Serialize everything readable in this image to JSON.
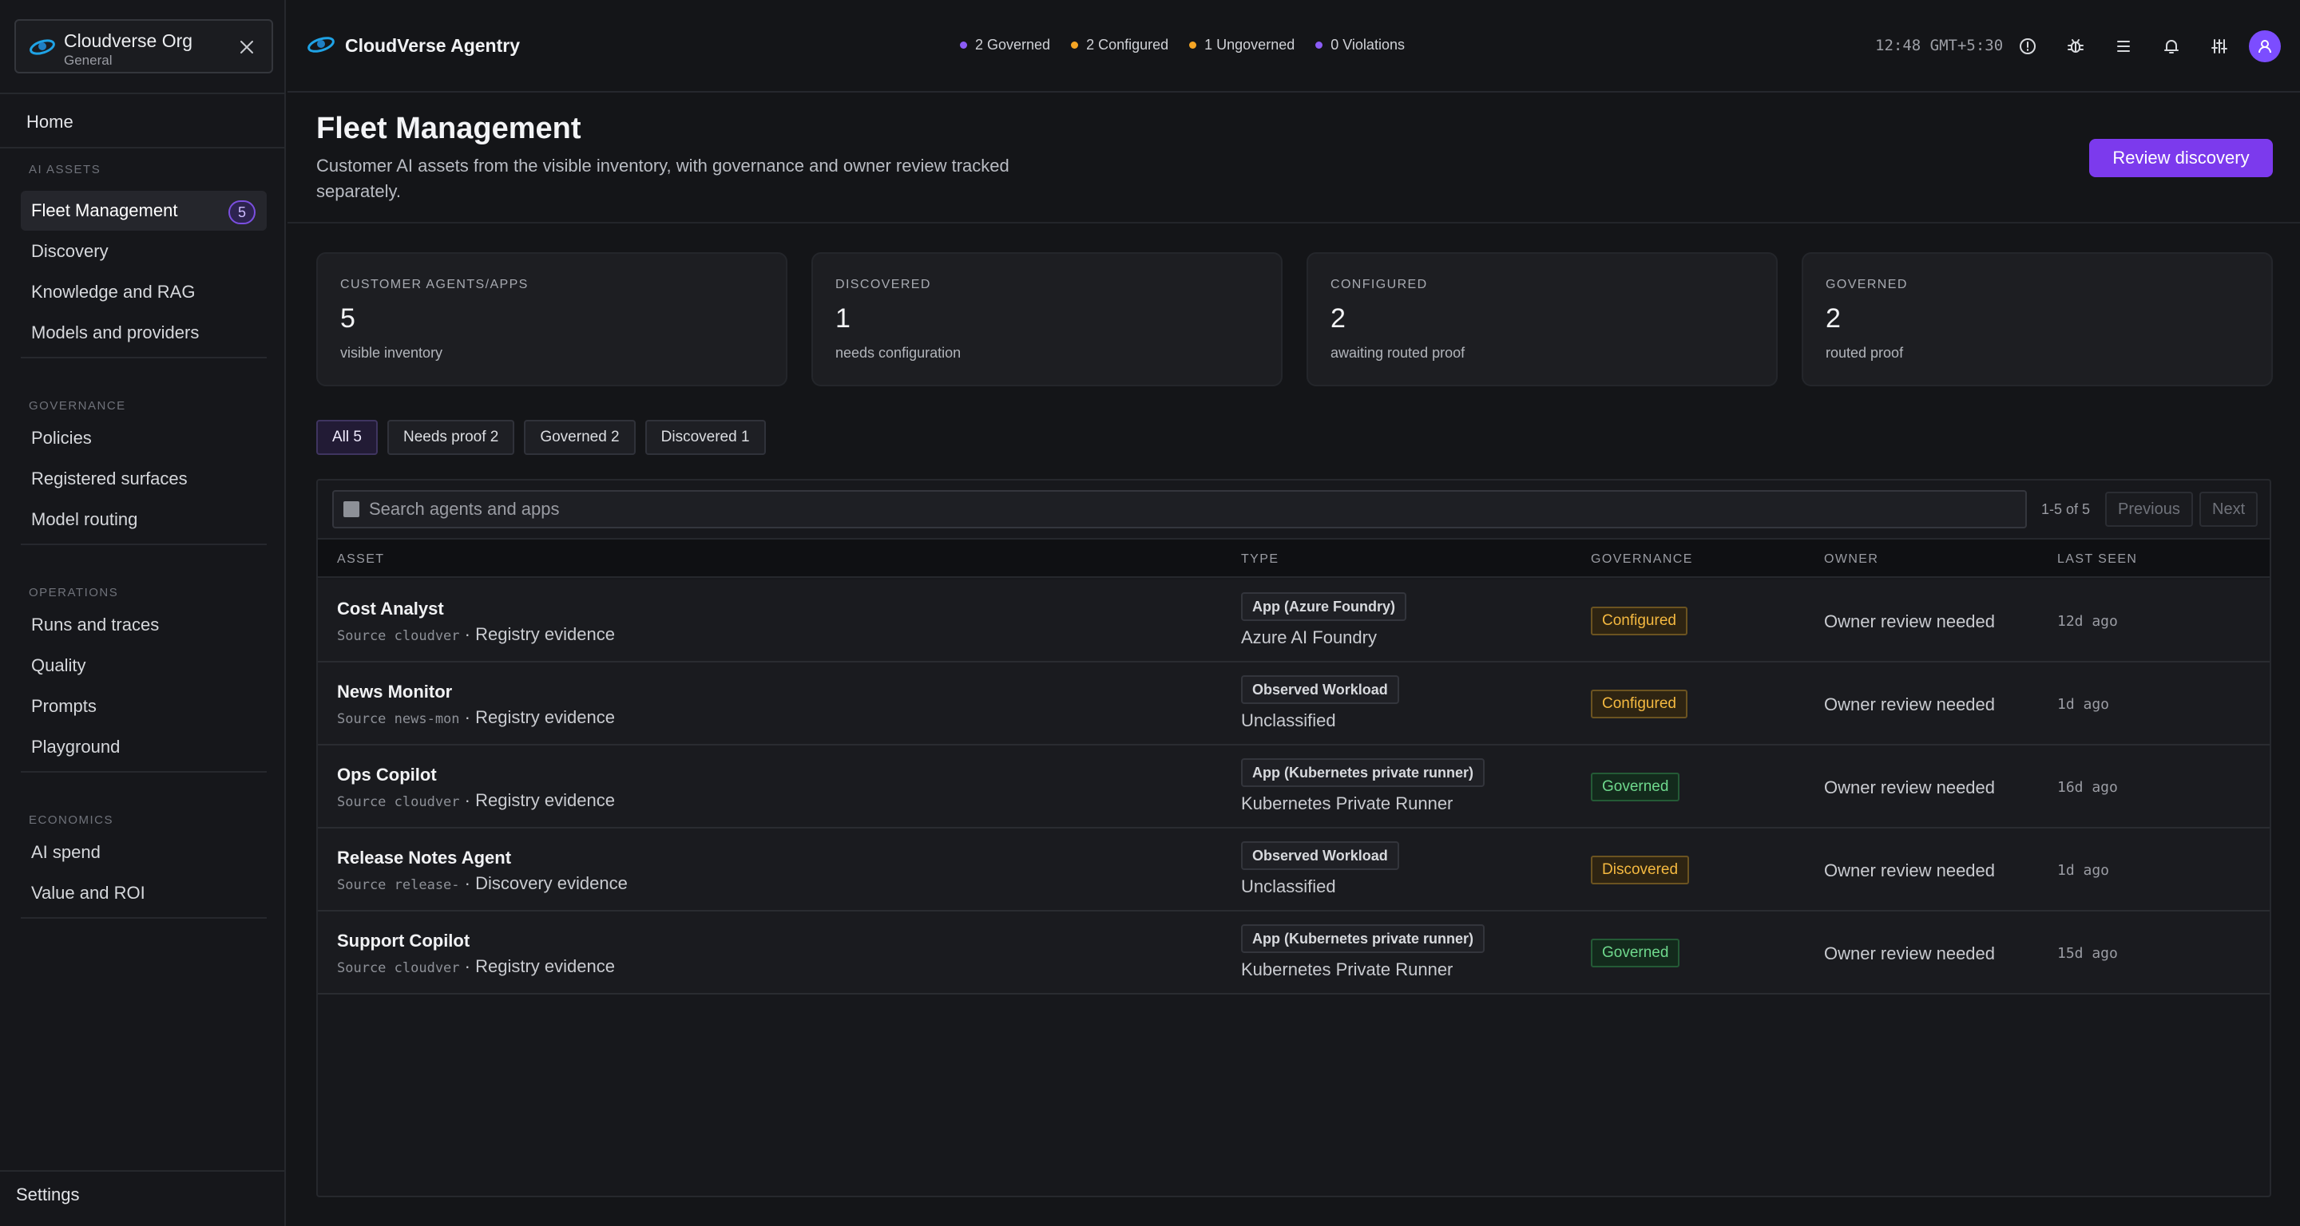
{
  "org": {
    "name": "Cloudverse Org",
    "workspace": "General"
  },
  "sidebar": {
    "home": "Home",
    "sections": [
      {
        "label": "AI ASSETS",
        "items": [
          {
            "label": "Fleet Management",
            "badge": "5",
            "active": true
          },
          {
            "label": "Discovery"
          },
          {
            "label": "Knowledge and RAG"
          },
          {
            "label": "Models and providers"
          }
        ]
      },
      {
        "label": "GOVERNANCE",
        "items": [
          {
            "label": "Policies"
          },
          {
            "label": "Registered surfaces"
          },
          {
            "label": "Model routing"
          }
        ]
      },
      {
        "label": "OPERATIONS",
        "items": [
          {
            "label": "Runs and traces"
          },
          {
            "label": "Quality"
          },
          {
            "label": "Prompts"
          },
          {
            "label": "Playground"
          }
        ]
      },
      {
        "label": "ECONOMICS",
        "items": [
          {
            "label": "AI spend"
          },
          {
            "label": "Value and ROI"
          }
        ]
      }
    ],
    "settings": "Settings"
  },
  "topbar": {
    "brand": "CloudVerse Agentry",
    "status": [
      {
        "label": "2 Governed",
        "color": "#8b5cf6"
      },
      {
        "label": "2 Configured",
        "color": "#f5a524"
      },
      {
        "label": "1 Ungoverned",
        "color": "#f5a524"
      },
      {
        "label": "0 Violations",
        "color": "#8b5cf6"
      }
    ],
    "clock": "12:48 GMT+5:30",
    "icons": [
      "info-icon",
      "bug-icon",
      "list-icon",
      "bell-icon",
      "sliders-icon",
      "user-icon"
    ]
  },
  "page": {
    "title": "Fleet Management",
    "subtitle": "Customer AI assets from the visible inventory, with governance and owner review tracked separately.",
    "primary_action": "Review discovery"
  },
  "stats": [
    {
      "label": "CUSTOMER AGENTS/APPS",
      "value": "5",
      "caption": "visible inventory"
    },
    {
      "label": "DISCOVERED",
      "value": "1",
      "caption": "needs configuration"
    },
    {
      "label": "CONFIGURED",
      "value": "2",
      "caption": "awaiting routed proof"
    },
    {
      "label": "GOVERNED",
      "value": "2",
      "caption": "routed proof"
    }
  ],
  "filters": [
    {
      "label": "All 5",
      "active": true
    },
    {
      "label": "Needs proof 2"
    },
    {
      "label": "Governed 2"
    },
    {
      "label": "Discovered 1"
    }
  ],
  "table": {
    "search_placeholder": "Search agents and apps",
    "range": "1-5 of 5",
    "prev": "Previous",
    "next": "Next",
    "columns": [
      "ASSET",
      "TYPE",
      "GOVERNANCE",
      "OWNER",
      "LAST SEEN"
    ],
    "rows": [
      {
        "name": "Cost Analyst",
        "source": "Source cloudver",
        "evidence": "· Registry evidence",
        "type": "App (Azure Foundry)",
        "type_sub": "Azure AI Foundry",
        "governance": "Configured",
        "owner": "Owner review needed",
        "seen": "12d ago"
      },
      {
        "name": "News Monitor",
        "source": "Source news-mon",
        "evidence": "· Registry evidence",
        "type": "Observed Workload",
        "type_sub": "Unclassified",
        "governance": "Configured",
        "owner": "Owner review needed",
        "seen": "1d ago"
      },
      {
        "name": "Ops Copilot",
        "source": "Source cloudver",
        "evidence": "· Registry evidence",
        "type": "App (Kubernetes private runner)",
        "type_sub": "Kubernetes Private Runner",
        "governance": "Governed",
        "owner": "Owner review needed",
        "seen": "16d ago"
      },
      {
        "name": "Release Notes Agent",
        "source": "Source release-",
        "evidence": "· Discovery evidence",
        "type": "Observed Workload",
        "type_sub": "Unclassified",
        "governance": "Discovered",
        "owner": "Owner review needed",
        "seen": "1d ago"
      },
      {
        "name": "Support Copilot",
        "source": "Source cloudver",
        "evidence": "· Registry evidence",
        "type": "App (Kubernetes private runner)",
        "type_sub": "Kubernetes Private Runner",
        "governance": "Governed",
        "owner": "Owner review needed",
        "seen": "15d ago"
      }
    ]
  },
  "governance_colors": {
    "Configured": {
      "text": "#f5b940",
      "bg": "#2e2412",
      "border": "#6b5320"
    },
    "Discovered": {
      "text": "#f5b940",
      "bg": "#2e2412",
      "border": "#6b5320"
    },
    "Governed": {
      "text": "#6fd98d",
      "bg": "#132a1c",
      "border": "#245a36"
    }
  }
}
